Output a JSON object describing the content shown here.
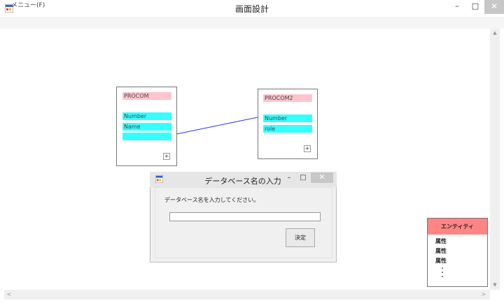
{
  "window": {
    "title": "画面設計",
    "min_glyph": "–",
    "max_glyph": "□",
    "close_glyph": "✕"
  },
  "menu": {
    "file": "メニュー(F)"
  },
  "tables": [
    {
      "title": "PROCOM",
      "attributes": [
        "Number",
        "Name",
        ""
      ],
      "add_glyph": "+"
    },
    {
      "title": "PROCOM2",
      "attributes": [
        "Number",
        "role"
      ],
      "add_glyph": "+"
    }
  ],
  "dialog": {
    "title": "データベース名の入力",
    "prompt": "データベース名を入力してください。",
    "input_value": "",
    "ok_label": "決定",
    "min_glyph": "–",
    "max_glyph": "□",
    "close_glyph": "✕"
  },
  "legend": {
    "header": "エンティティ",
    "items": [
      "属性",
      "属性",
      "属性"
    ],
    "ellipsis_dots": [
      "・",
      "・",
      "・"
    ]
  },
  "scrollbars": {
    "up": "▲",
    "down": "▼",
    "left": "<",
    "right": ">"
  },
  "colors": {
    "entity_title": "#ffc4cc",
    "attribute": "#33ffff",
    "relation_line": "#2233ee",
    "legend_header": "#ff8585"
  },
  "icons": {
    "app": "app-window-icon",
    "dialog": "app-window-icon"
  }
}
